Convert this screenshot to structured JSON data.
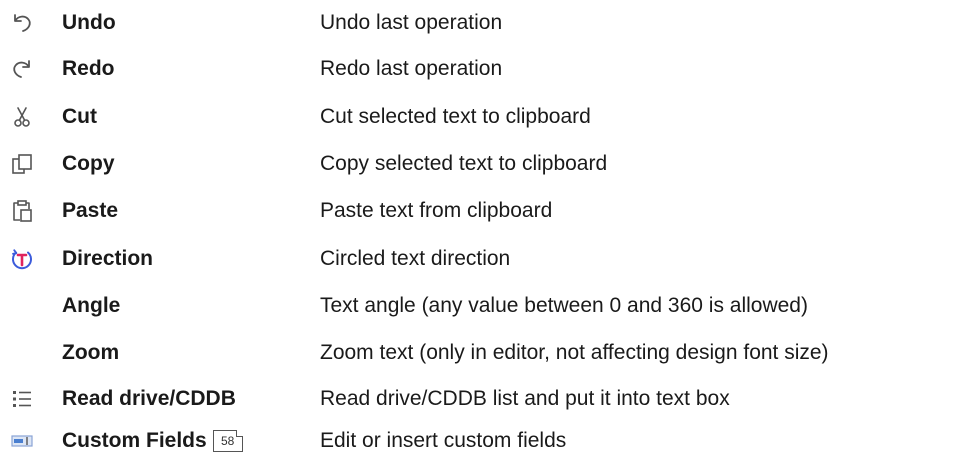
{
  "rows": [
    {
      "icon": "undo-icon",
      "name": "Undo",
      "desc": "Undo last operation"
    },
    {
      "icon": "redo-icon",
      "name": "Redo",
      "desc": "Redo last operation"
    },
    {
      "icon": "cut-icon",
      "name": "Cut",
      "desc": "Cut selected text to clipboard"
    },
    {
      "icon": "copy-icon",
      "name": "Copy",
      "desc": "Copy selected text to clipboard"
    },
    {
      "icon": "paste-icon",
      "name": "Paste",
      "desc": "Paste text from clipboard"
    },
    {
      "icon": "direction-icon",
      "name": "Direction",
      "desc": "Circled text direction"
    },
    {
      "icon": "",
      "name": "Angle",
      "desc": "Text angle (any value between 0 and 360 is allowed)"
    },
    {
      "icon": "",
      "name": "Zoom",
      "desc": "Zoom text (only in editor, not affecting design font size)"
    },
    {
      "icon": "list-icon",
      "name": "Read drive/CDDB",
      "desc": "Read drive/CDDB list and put it into text box"
    },
    {
      "icon": "custom-fields-icon",
      "name": "Custom Fields",
      "page_ref": "58",
      "desc": "Edit or insert custom fields"
    }
  ],
  "colors": {
    "direction_ring": "#3b5bdb",
    "direction_letter": "#e0245e",
    "icon_gray": "#555555",
    "custom_fields_blue": "#4a7fd0"
  }
}
